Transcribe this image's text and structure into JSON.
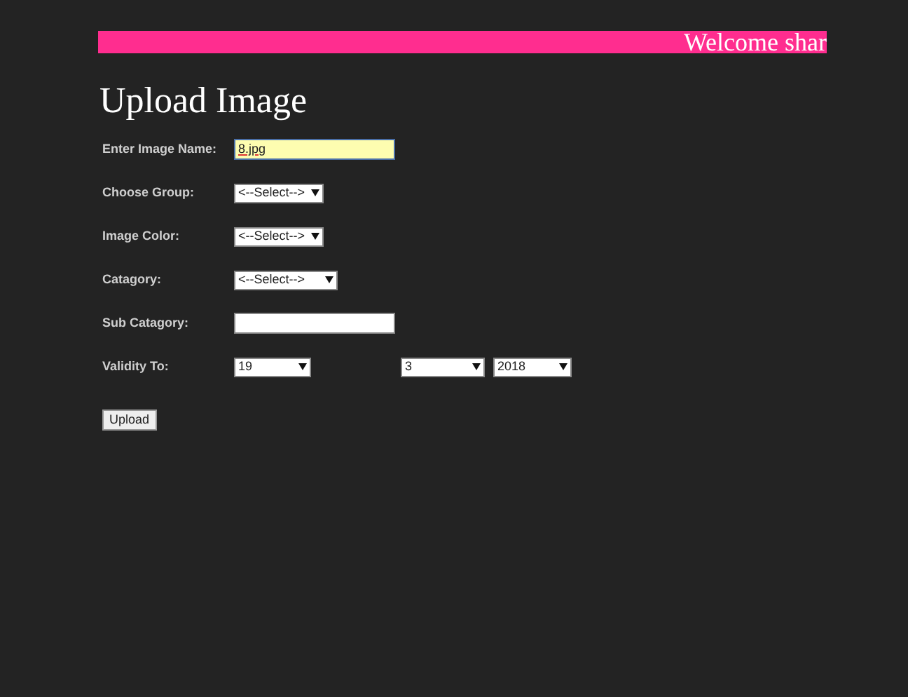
{
  "banner": {
    "text": "Welcome shar"
  },
  "title": "Upload Image",
  "form": {
    "rows": [
      {
        "label": "Enter Image Name:",
        "kind": "text",
        "value": "8.jpg",
        "highlighted": true
      },
      {
        "label": "Choose Group:",
        "kind": "select",
        "value": "<--Select-->"
      },
      {
        "label": "Image Color:",
        "kind": "select",
        "value": "<--Select-->"
      },
      {
        "label": "Catagory:",
        "kind": "select",
        "value": "<--Select-->"
      },
      {
        "label": "Sub Catagory:",
        "kind": "text",
        "value": "",
        "highlighted": false
      },
      {
        "label": "Validity To:",
        "kind": "date",
        "day": "19",
        "month": "3",
        "year": "2018"
      }
    ],
    "submit": "Upload"
  }
}
